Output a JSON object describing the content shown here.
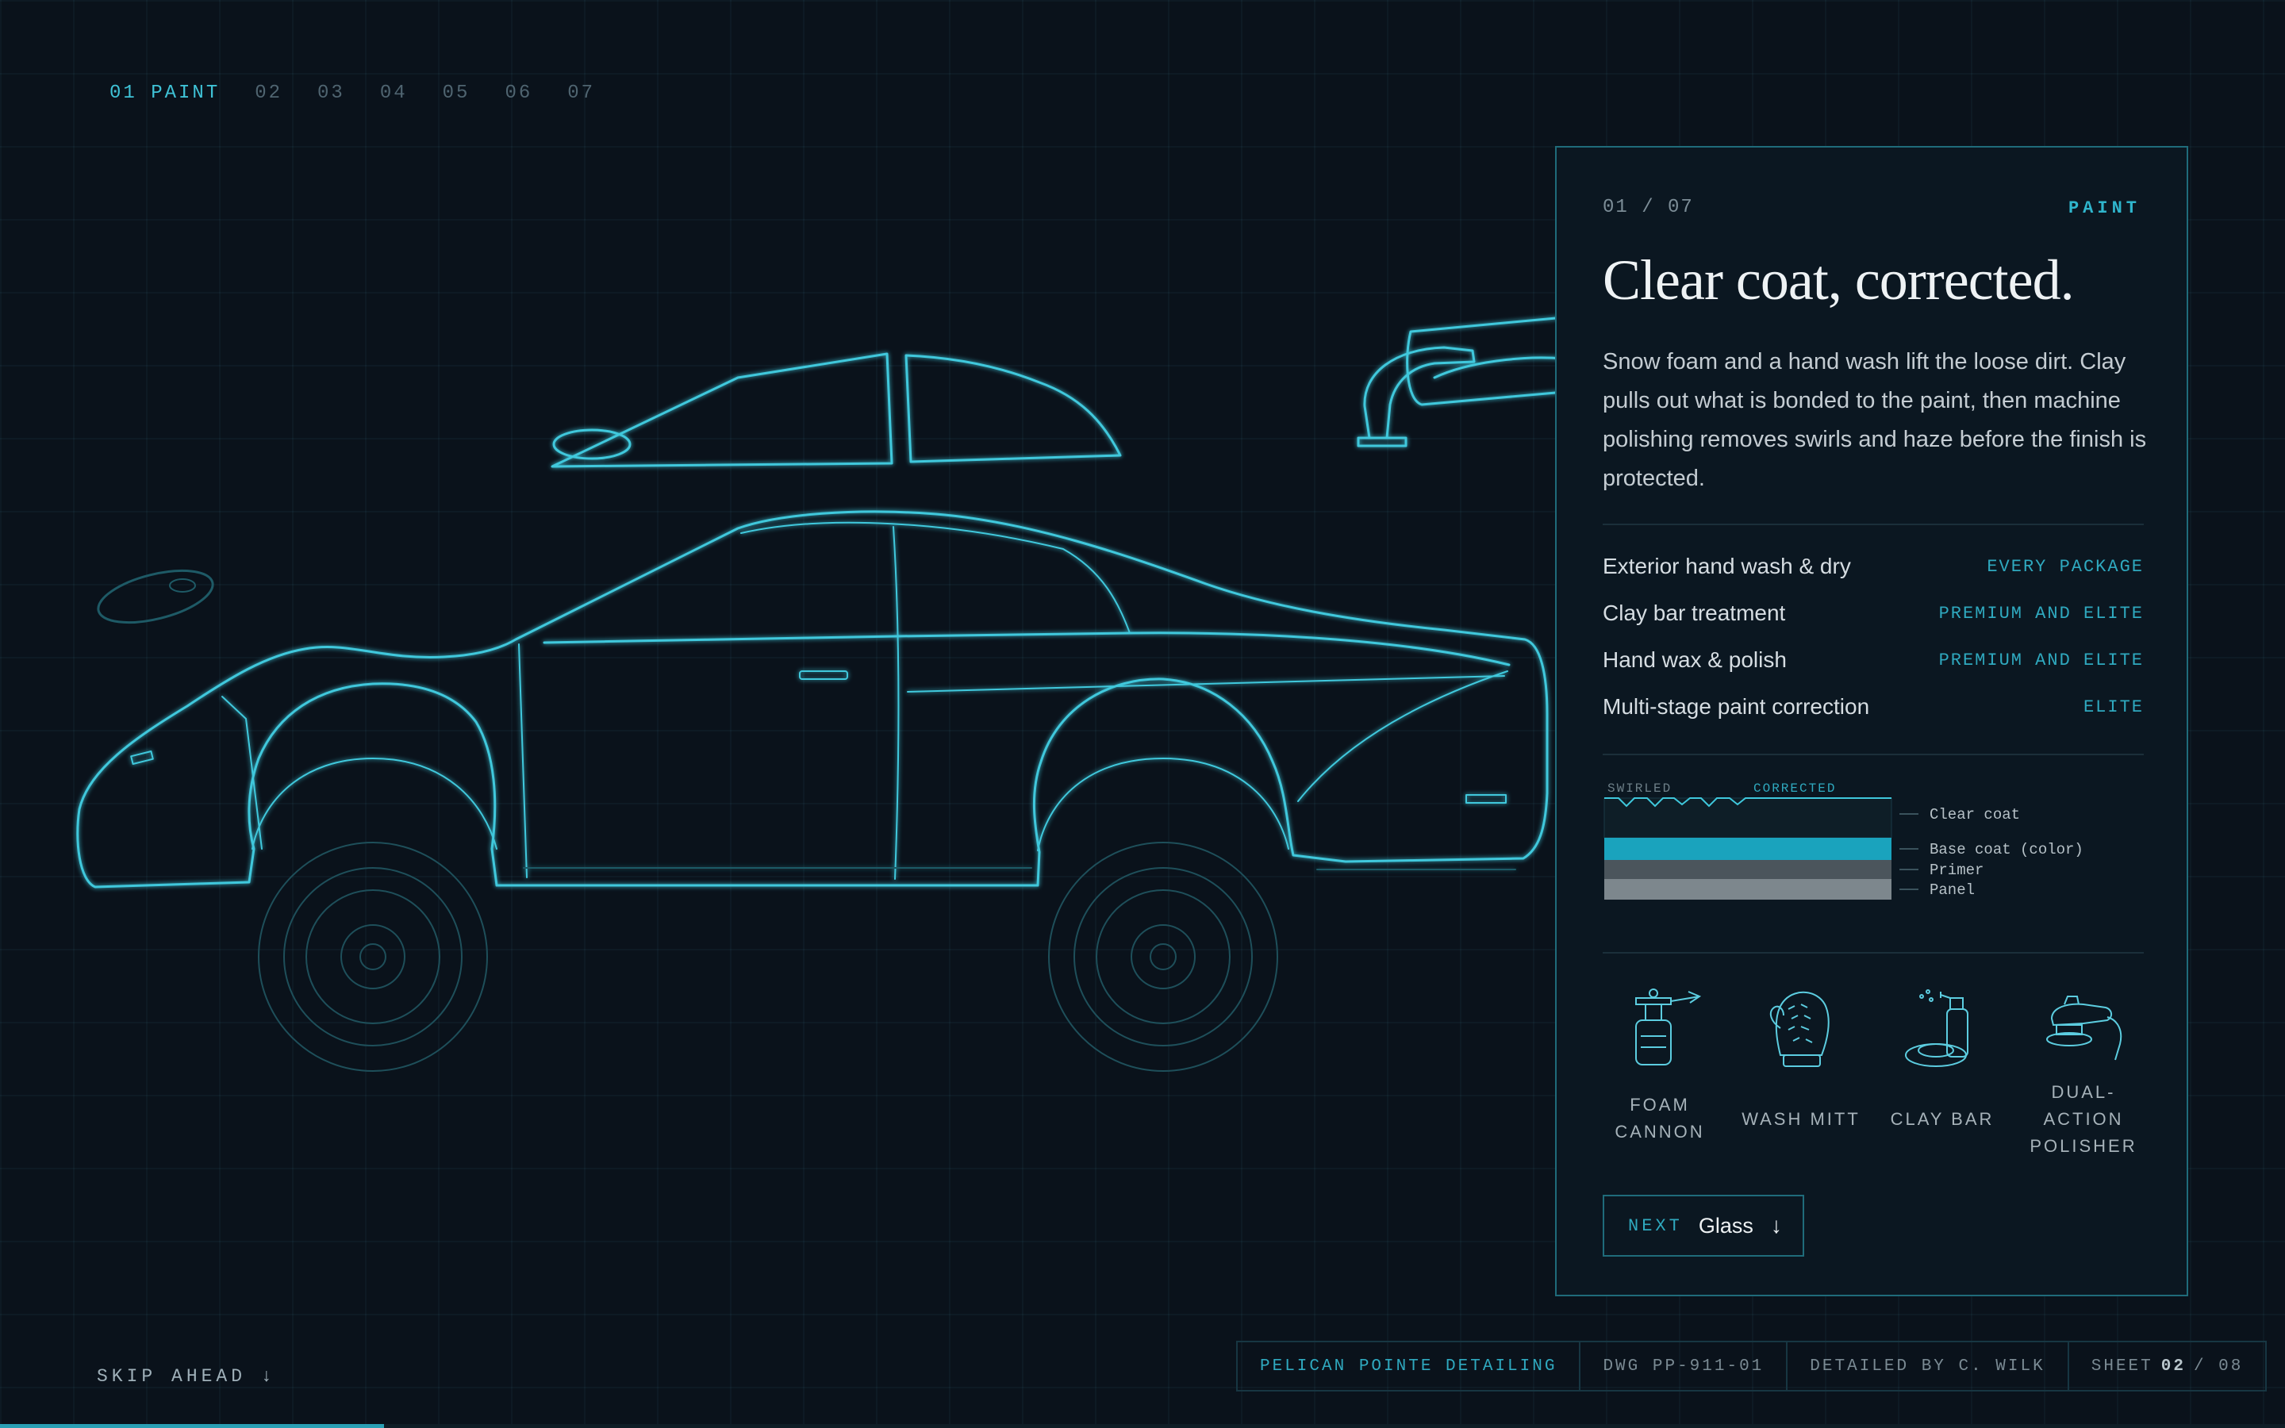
{
  "steps": [
    {
      "label": "01 PAINT",
      "active": true
    },
    {
      "label": "02"
    },
    {
      "label": "03"
    },
    {
      "label": "04"
    },
    {
      "label": "05"
    },
    {
      "label": "06"
    },
    {
      "label": "07"
    }
  ],
  "panel": {
    "counter": "01 / 07",
    "section": "PAINT",
    "title": "Clear coat, corrected.",
    "body": "Snow foam and a hand wash lift the loose dirt. Clay pulls out what is bonded to the paint, then machine polishing removes swirls and haze before the finish is protected.",
    "services": [
      {
        "name": "Exterior hand wash & dry",
        "tier": "EVERY PACKAGE"
      },
      {
        "name": "Clay bar treatment",
        "tier": "PREMIUM AND ELITE"
      },
      {
        "name": "Hand wax & polish",
        "tier": "PREMIUM AND ELITE"
      },
      {
        "name": "Multi-stage paint correction",
        "tier": "ELITE"
      }
    ],
    "layers": {
      "before_label": "SWIRLED",
      "after_label": "CORRECTED",
      "items": [
        "Clear coat",
        "Base coat (color)",
        "Primer",
        "Panel"
      ]
    },
    "tools": [
      {
        "label_l1": "FOAM",
        "label_l2": "CANNON",
        "label_l3": "",
        "icon": "foam-cannon-icon"
      },
      {
        "label_l1": "WASH MITT",
        "label_l2": "",
        "label_l3": "",
        "icon": "wash-mitt-icon"
      },
      {
        "label_l1": "CLAY BAR",
        "label_l2": "",
        "label_l3": "",
        "icon": "clay-bar-icon"
      },
      {
        "label_l1": "DUAL-",
        "label_l2": "ACTION",
        "label_l3": "POLISHER",
        "icon": "polisher-icon"
      }
    ],
    "next": {
      "kicker": "NEXT",
      "label": "Glass",
      "arrow": "↓"
    }
  },
  "skip": "SKIP AHEAD ↓",
  "title_block": {
    "brand": "PELICAN POINTE DETAILING",
    "dwg": "DWG PP-911-01",
    "detailed_by": "DETAILED BY C. WILK",
    "sheet_prefix": "SHEET",
    "sheet_current": "02",
    "sheet_suffix": "/ 08"
  },
  "progress": 0.168,
  "colors": {
    "accent": "#3fc2d6",
    "background": "#0a121b",
    "panel": "#0b1721",
    "base_coat": "#1aa3bd",
    "primer": "#4b555c",
    "panel_metal": "#7d878d"
  }
}
